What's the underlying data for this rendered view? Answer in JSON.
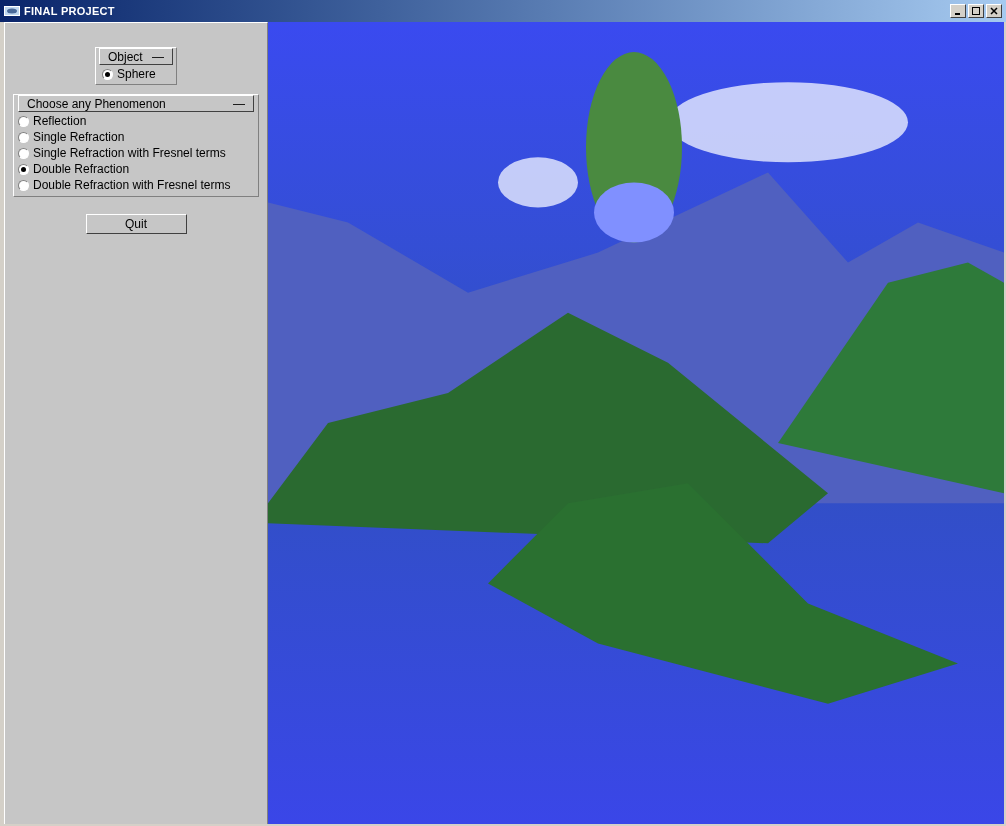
{
  "window": {
    "title": "FINAL PROJECT"
  },
  "object_panel": {
    "title": "Object",
    "collapse": "—",
    "options": [
      {
        "label": "Sphere",
        "selected": true
      }
    ]
  },
  "phenomenon_panel": {
    "title": "Choose any Phenomenon",
    "collapse": "—",
    "options": [
      {
        "label": "Reflection",
        "selected": false
      },
      {
        "label": "Single Refraction",
        "selected": false
      },
      {
        "label": "Single Refraction with Fresnel terms",
        "selected": false
      },
      {
        "label": "Double Refraction",
        "selected": true
      },
      {
        "label": "Double Refraction with Fresnel terms",
        "selected": false
      }
    ]
  },
  "quit_button": {
    "label": "Quit"
  }
}
